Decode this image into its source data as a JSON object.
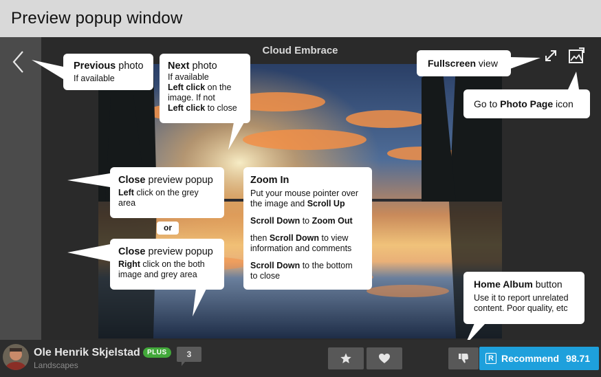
{
  "page": {
    "heading": "Preview popup window"
  },
  "viewer": {
    "photo_title": "Cloud Embrace"
  },
  "callouts": {
    "previous": {
      "title_bold": "Previous",
      "title_rest": " photo",
      "line": "If available"
    },
    "next": {
      "title_bold": "Next",
      "title_rest": " photo",
      "line1": "If available",
      "line2_bold": "Left click",
      "line2_rest": " on the",
      "line3": "image. If not",
      "line4_bold": "Left click",
      "line4_rest": " to close"
    },
    "fullscreen": {
      "bold": "Fullscreen",
      "rest": " view"
    },
    "photo_page": {
      "pre": "Go to ",
      "bold": "Photo Page",
      "post": " icon"
    },
    "close_left": {
      "title_bold": "Close",
      "title_rest": " preview popup",
      "line_bold": "Left",
      "line_rest": " click on the grey",
      "line2": "area"
    },
    "or": "or",
    "close_right": {
      "title_bold": "Close",
      "title_rest": " preview popup",
      "line_bold": "Right",
      "line_rest": " click on the both",
      "line2": "image and grey area"
    },
    "zoom": {
      "title": "Zoom In",
      "p1_a": "Put your mouse pointer over",
      "p1_b": "the image and ",
      "p1_bold": "Scroll Up",
      "p2_bold1": "Scroll Down",
      "p2_mid": " to ",
      "p2_bold2": "Zoom Out",
      "p3_pre": "then ",
      "p3_bold": "Scroll Down",
      "p3_post": " to view",
      "p3_b": "information and comments",
      "p4_bold": "Scroll Down",
      "p4_post": " to the bottom",
      "p4_b": "to close"
    },
    "home_album": {
      "title_bold": "Home Album",
      "title_rest": " button",
      "line1": "Use it to report unrelated",
      "line2": "content. Poor quality, etc"
    }
  },
  "footer": {
    "author": "Ole Henrik Skjelstad",
    "badge": "PLUS",
    "category": "Landscapes",
    "comments": "3",
    "recommend_label": "Recommend",
    "recommend_badge": "R",
    "score": "98.71"
  },
  "colors": {
    "recommend": "#1ea0dc",
    "plus_badge": "#42a83a"
  },
  "icons": [
    "chevron-left-icon",
    "expand-icon",
    "photo-page-icon",
    "star-icon",
    "heart-icon",
    "thumbs-down-icon"
  ]
}
